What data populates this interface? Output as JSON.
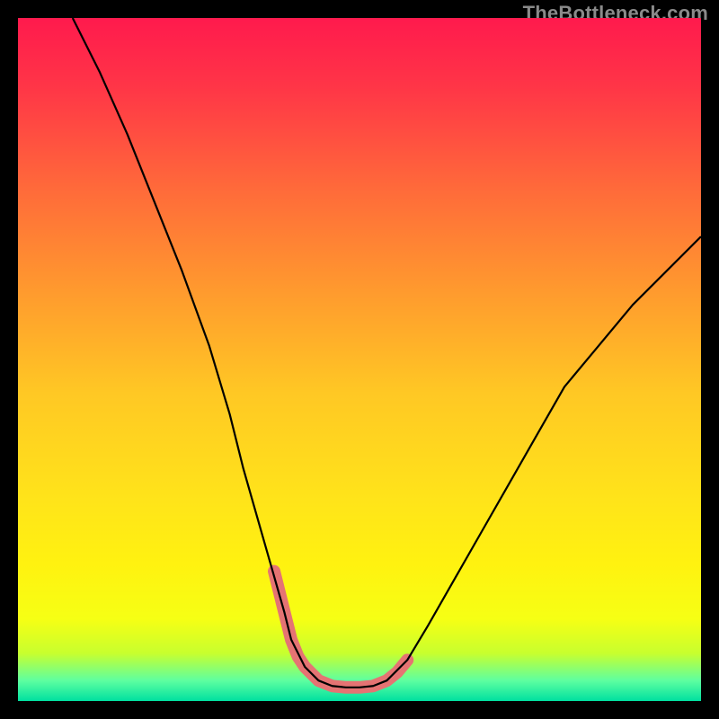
{
  "watermark": "TheBottleneck.com",
  "gradient": {
    "stops": [
      {
        "offset": 0.0,
        "color": "#ff1a4d"
      },
      {
        "offset": 0.1,
        "color": "#ff3547"
      },
      {
        "offset": 0.25,
        "color": "#ff6a3a"
      },
      {
        "offset": 0.4,
        "color": "#ff9a2e"
      },
      {
        "offset": 0.55,
        "color": "#ffc824"
      },
      {
        "offset": 0.7,
        "color": "#ffe31a"
      },
      {
        "offset": 0.8,
        "color": "#fff210"
      },
      {
        "offset": 0.88,
        "color": "#f6ff14"
      },
      {
        "offset": 0.93,
        "color": "#c8ff2e"
      },
      {
        "offset": 0.97,
        "color": "#5effa0"
      },
      {
        "offset": 1.0,
        "color": "#00e0a0"
      }
    ]
  },
  "chart_data": {
    "type": "line",
    "title": "",
    "xlabel": "",
    "ylabel": "",
    "xlim": [
      0,
      100
    ],
    "ylim": [
      0,
      100
    ],
    "series": [
      {
        "name": "curve",
        "stroke": "#000000",
        "width": 2.2,
        "x": [
          8,
          12,
          16,
          20,
          24,
          28,
          31,
          33,
          35,
          37,
          39,
          40,
          42,
          44,
          46,
          48,
          50,
          52,
          54,
          57,
          60,
          64,
          68,
          72,
          76,
          80,
          85,
          90,
          95,
          100
        ],
        "y": [
          100,
          92,
          83,
          73,
          63,
          52,
          42,
          34,
          27,
          20,
          13,
          9,
          5,
          3,
          2.2,
          2,
          2,
          2.2,
          3,
          6,
          11,
          18,
          25,
          32,
          39,
          46,
          52,
          58,
          63,
          68
        ]
      },
      {
        "name": "highlight",
        "stroke": "#e57373",
        "width": 14,
        "linecap": "round",
        "x": [
          37.5,
          39,
          40,
          41,
          42,
          44,
          46,
          48,
          50,
          52,
          54,
          55.5,
          57
        ],
        "y": [
          19,
          13,
          9,
          6.5,
          5,
          3,
          2.2,
          2,
          2,
          2.2,
          3,
          4.2,
          6
        ]
      }
    ]
  }
}
